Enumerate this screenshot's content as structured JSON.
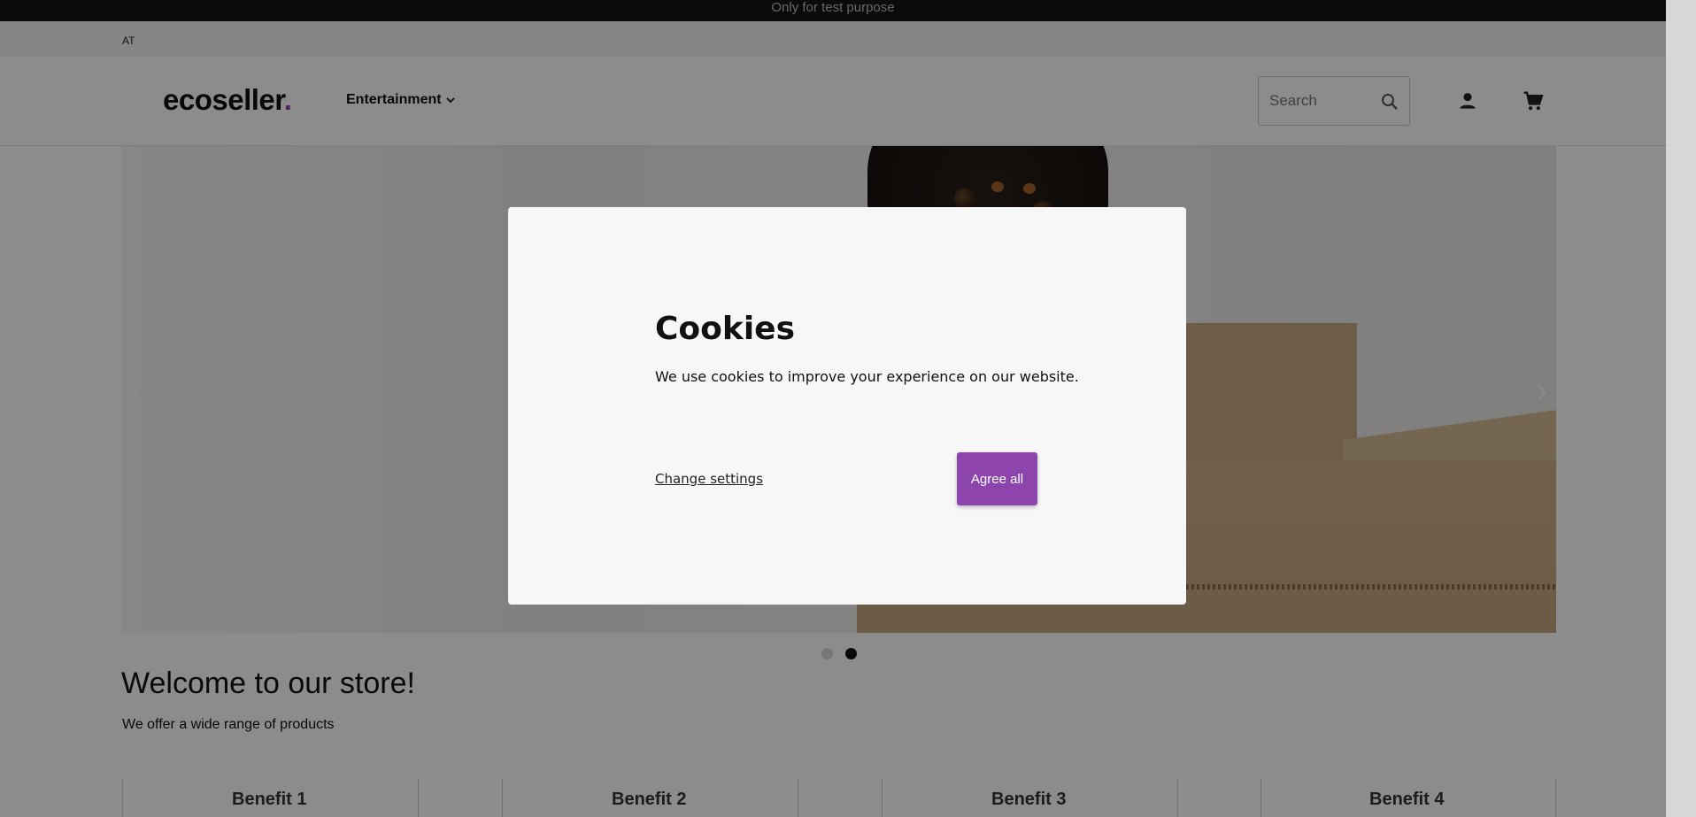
{
  "test_banner": "Only for test purpose",
  "region_code": "AT",
  "header": {
    "logo_text": "ecoseller",
    "logo_dot": ".",
    "nav_category": "Entertainment",
    "search_placeholder": "Search",
    "icons": [
      "search-icon",
      "user-icon",
      "cart-icon",
      "chevron-down-icon"
    ]
  },
  "hero": {
    "prev_arrow": "‹",
    "next_arrow": "›",
    "slide_count": 2,
    "active_slide": 2
  },
  "welcome": {
    "title": "Welcome to our store!",
    "subtitle": "We offer a wide range of products"
  },
  "benefits": [
    "Benefit 1",
    "Benefit 2",
    "Benefit 3",
    "Benefit 4"
  ],
  "cookie_modal": {
    "title": "Cookies",
    "text": "We use cookies to improve your experience on our website.",
    "change_settings": "Change settings",
    "agree_all": "Agree all"
  },
  "colors": {
    "accent": "#8e44ad",
    "top_bar": "#141414"
  }
}
